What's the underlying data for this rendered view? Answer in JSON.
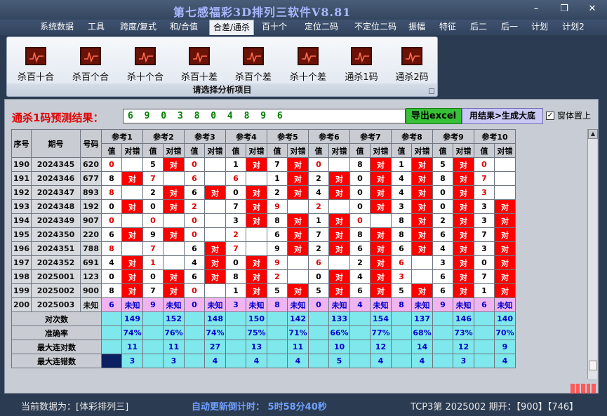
{
  "window": {
    "title": "第七感福彩3D排列三软件V8.81",
    "buttons": [
      "–",
      "❐",
      "✕"
    ]
  },
  "menu": [
    {
      "label": "系统数据",
      "active": false
    },
    {
      "label": "工具",
      "active": false
    },
    {
      "label": "跨度/复式",
      "active": false
    },
    {
      "label": "和/合值",
      "active": false
    },
    {
      "label": "合差/通杀",
      "active": true
    },
    {
      "label": "百十个",
      "active": false
    },
    {
      "label": "定位二码",
      "active": false
    },
    {
      "label": "不定位二码",
      "active": false
    },
    {
      "label": "振幅",
      "active": false
    },
    {
      "label": "特征",
      "active": false
    },
    {
      "label": "后二",
      "active": false
    },
    {
      "label": "后一",
      "active": false
    },
    {
      "label": "计划",
      "active": false
    },
    {
      "label": "计划2",
      "active": false
    }
  ],
  "ribbon": {
    "buttons": [
      "杀百十合",
      "杀百个合",
      "杀十个合",
      "杀百十差",
      "杀百个差",
      "杀十个差",
      "通杀1码",
      "通杀2码"
    ],
    "caption": "请选择分析项目"
  },
  "result": {
    "label": "通杀1码预测结果：",
    "value": "6 9 0 3 8 0 4 8 9 6",
    "export_button": "导出excel",
    "generate_button": "用结果>生成大底",
    "topmost_checkbox": "窗体置上",
    "topmost_checked": true
  },
  "table": {
    "col_seq": "序号",
    "col_period": "期号",
    "col_number": "号码",
    "groups": [
      "参考1",
      "参考2",
      "参考3",
      "参考4",
      "参考5",
      "参考6",
      "参考7",
      "参考8",
      "参考9",
      "参考10"
    ],
    "sub_value": "值",
    "sub_result": "对错",
    "hit_text": "对",
    "rows": [
      {
        "seq": "190",
        "period": "2024345",
        "num": "620",
        "refs": [
          [
            "0",
            "",
            1
          ],
          [
            "5",
            "对",
            0
          ],
          [
            "0",
            "",
            1
          ],
          [
            "1",
            "对",
            0
          ],
          [
            "7",
            "对",
            0
          ],
          [
            "0",
            "",
            1
          ],
          [
            "8",
            "对",
            0
          ],
          [
            "1",
            "对",
            0
          ],
          [
            "5",
            "对",
            0
          ],
          [
            "0",
            "",
            1
          ]
        ]
      },
      {
        "seq": "191",
        "period": "2024346",
        "num": "677",
        "refs": [
          [
            "8",
            "对",
            0
          ],
          [
            "7",
            "",
            1
          ],
          [
            "6",
            "",
            1
          ],
          [
            "6",
            "",
            1
          ],
          [
            "1",
            "对",
            0
          ],
          [
            "2",
            "对",
            0
          ],
          [
            "0",
            "对",
            0
          ],
          [
            "4",
            "对",
            0
          ],
          [
            "8",
            "对",
            0
          ],
          [
            "7",
            "",
            1
          ]
        ]
      },
      {
        "seq": "192",
        "period": "2024347",
        "num": "893",
        "refs": [
          [
            "8",
            "",
            1
          ],
          [
            "2",
            "对",
            0
          ],
          [
            "6",
            "对",
            0
          ],
          [
            "0",
            "对",
            0
          ],
          [
            "2",
            "对",
            0
          ],
          [
            "4",
            "对",
            0
          ],
          [
            "0",
            "对",
            0
          ],
          [
            "4",
            "对",
            0
          ],
          [
            "0",
            "对",
            0
          ],
          [
            "3",
            "",
            1
          ]
        ]
      },
      {
        "seq": "193",
        "period": "2024348",
        "num": "192",
        "refs": [
          [
            "0",
            "对",
            0
          ],
          [
            "0",
            "对",
            0
          ],
          [
            "2",
            "",
            1
          ],
          [
            "7",
            "对",
            0
          ],
          [
            "9",
            "",
            1
          ],
          [
            "2",
            "",
            1
          ],
          [
            "0",
            "对",
            0
          ],
          [
            "3",
            "对",
            0
          ],
          [
            "0",
            "对",
            0
          ],
          [
            "3",
            "对",
            0
          ]
        ]
      },
      {
        "seq": "194",
        "period": "2024349",
        "num": "907",
        "refs": [
          [
            "0",
            "",
            1
          ],
          [
            "0",
            "",
            1
          ],
          [
            "0",
            "",
            1
          ],
          [
            "3",
            "对",
            0
          ],
          [
            "8",
            "对",
            0
          ],
          [
            "1",
            "对",
            0
          ],
          [
            "0",
            "",
            1
          ],
          [
            "8",
            "对",
            0
          ],
          [
            "2",
            "对",
            0
          ],
          [
            "3",
            "对",
            0
          ]
        ]
      },
      {
        "seq": "195",
        "period": "2024350",
        "num": "220",
        "refs": [
          [
            "6",
            "对",
            0
          ],
          [
            "9",
            "对",
            0
          ],
          [
            "0",
            "",
            1
          ],
          [
            "2",
            "",
            1
          ],
          [
            "6",
            "对",
            0
          ],
          [
            "7",
            "对",
            0
          ],
          [
            "8",
            "对",
            0
          ],
          [
            "8",
            "对",
            0
          ],
          [
            "6",
            "对",
            0
          ],
          [
            "7",
            "对",
            0
          ]
        ]
      },
      {
        "seq": "196",
        "period": "2024351",
        "num": "788",
        "refs": [
          [
            "8",
            "",
            1
          ],
          [
            "7",
            "",
            1
          ],
          [
            "6",
            "对",
            0
          ],
          [
            "7",
            "",
            1
          ],
          [
            "9",
            "对",
            0
          ],
          [
            "2",
            "对",
            0
          ],
          [
            "6",
            "对",
            0
          ],
          [
            "6",
            "对",
            0
          ],
          [
            "4",
            "对",
            0
          ],
          [
            "3",
            "对",
            0
          ]
        ]
      },
      {
        "seq": "197",
        "period": "2024352",
        "num": "691",
        "refs": [
          [
            "4",
            "对",
            0
          ],
          [
            "1",
            "",
            1
          ],
          [
            "4",
            "对",
            0
          ],
          [
            "0",
            "对",
            0
          ],
          [
            "9",
            "",
            1
          ],
          [
            "6",
            "",
            1
          ],
          [
            "2",
            "对",
            0
          ],
          [
            "6",
            "",
            1
          ],
          [
            "3",
            "对",
            0
          ],
          [
            "0",
            "对",
            0
          ]
        ]
      },
      {
        "seq": "198",
        "period": "2025001",
        "num": "123",
        "refs": [
          [
            "0",
            "对",
            0
          ],
          [
            "0",
            "对",
            0
          ],
          [
            "6",
            "对",
            0
          ],
          [
            "8",
            "对",
            0
          ],
          [
            "2",
            "",
            1
          ],
          [
            "0",
            "对",
            0
          ],
          [
            "4",
            "对",
            0
          ],
          [
            "3",
            "",
            1
          ],
          [
            "6",
            "对",
            0
          ],
          [
            "7",
            "对",
            0
          ]
        ]
      },
      {
        "seq": "199",
        "period": "2025002",
        "num": "900",
        "refs": [
          [
            "8",
            "对",
            0
          ],
          [
            "7",
            "对",
            0
          ],
          [
            "0",
            "",
            1
          ],
          [
            "1",
            "对",
            0
          ],
          [
            "5",
            "对",
            0
          ],
          [
            "5",
            "对",
            0
          ],
          [
            "6",
            "对",
            0
          ],
          [
            "5",
            "对",
            0
          ],
          [
            "6",
            "对",
            0
          ],
          [
            "1",
            "对",
            0
          ]
        ]
      }
    ],
    "predict_row": {
      "seq": "200",
      "period": "2025003",
      "num": "未知",
      "values": [
        "6",
        "9",
        "0",
        "3",
        "8",
        "0",
        "4",
        "8",
        "9",
        "6"
      ],
      "unknown": "未知"
    },
    "stats": [
      {
        "label": "对次数",
        "values": [
          "149",
          "152",
          "148",
          "150",
          "142",
          "133",
          "154",
          "137",
          "146",
          "140"
        ]
      },
      {
        "label": "准确率",
        "values": [
          "74%",
          "76%",
          "74%",
          "75%",
          "71%",
          "66%",
          "77%",
          "68%",
          "73%",
          "70%"
        ]
      },
      {
        "label": "最大连对数",
        "values": [
          "11",
          "11",
          "27",
          "13",
          "11",
          "10",
          "12",
          "14",
          "12",
          "9"
        ]
      },
      {
        "label": "最大连错数",
        "values": [
          "3",
          "3",
          "4",
          "4",
          "4",
          "5",
          "4",
          "4",
          "3",
          "4"
        ]
      }
    ]
  },
  "status": {
    "current_data": "当前数据为：[体彩排列三]",
    "countdown": "自动更新倒计时： 5时58分40秒",
    "draw_info": "TCP3第 2025002 期开：【900】【746】"
  }
}
